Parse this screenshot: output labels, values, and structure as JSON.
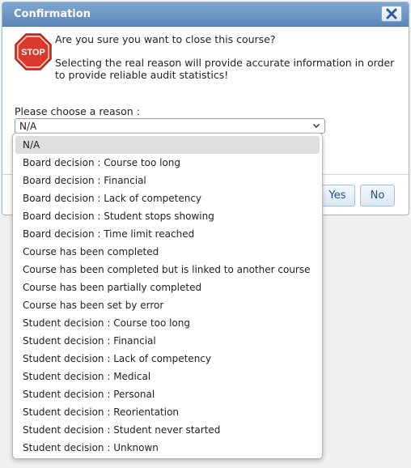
{
  "dialog": {
    "title": "Confirmation",
    "question": "Are you sure you want to close this course?",
    "info": "Selecting the real reason will provide accurate information in order to provide reliable audit statistics!",
    "stop_text": "STOP",
    "reason_label": "Please choose a reason :",
    "selected_reason": "N/A",
    "yes_label": "Yes",
    "no_label": "No",
    "icons": {
      "close": "close-icon",
      "stop": "stop-sign-icon",
      "dropdown": "chevron-down-icon"
    },
    "colors": {
      "titlebar": "#6b96c6",
      "stop_red": "#d93a2b",
      "button_text": "#1f4f86"
    }
  },
  "dropdown": {
    "options": [
      "N/A",
      "Board decision : Course too long",
      "Board decision : Financial",
      "Board decision : Lack of competency",
      "Board decision : Student stops showing",
      "Board decision : Time limit reached",
      "Course has been completed",
      "Course has been completed but is linked to another course",
      "Course has been partially completed",
      "Course has been set by error",
      "Student decision : Course too long",
      "Student decision : Financial",
      "Student decision : Lack of competency",
      "Student decision : Medical",
      "Student decision : Personal",
      "Student decision : Reorientation",
      "Student decision : Student never started",
      "Student decision : Unknown"
    ],
    "selected_index": 0
  }
}
